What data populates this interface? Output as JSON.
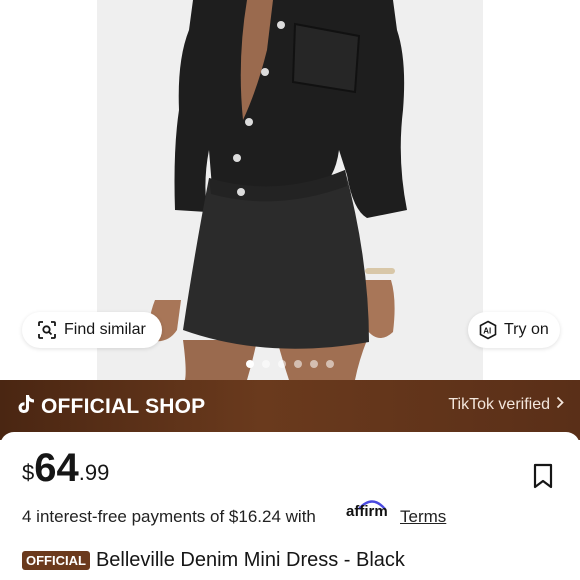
{
  "product_image": {
    "actions": {
      "find_similar": "Find similar",
      "try_on": "Try on"
    },
    "carousel": {
      "total": 6,
      "active": 1
    }
  },
  "shop_bar": {
    "brand": "OFFICIAL SHOP",
    "verified": "TikTok verified"
  },
  "pricing": {
    "currency": "$",
    "main": "64",
    "cents": ".99",
    "installments": "4 interest-free payments of $16.24 with",
    "provider": "affirm",
    "terms": "Terms"
  },
  "product": {
    "badge": "OFFICIAL",
    "title": "Belleville Denim Mini Dress - Black"
  },
  "colors": {
    "shop_bar": "#5a2f18",
    "badge": "#6b3a1d",
    "affirm_blue": "#4a4ae0"
  }
}
